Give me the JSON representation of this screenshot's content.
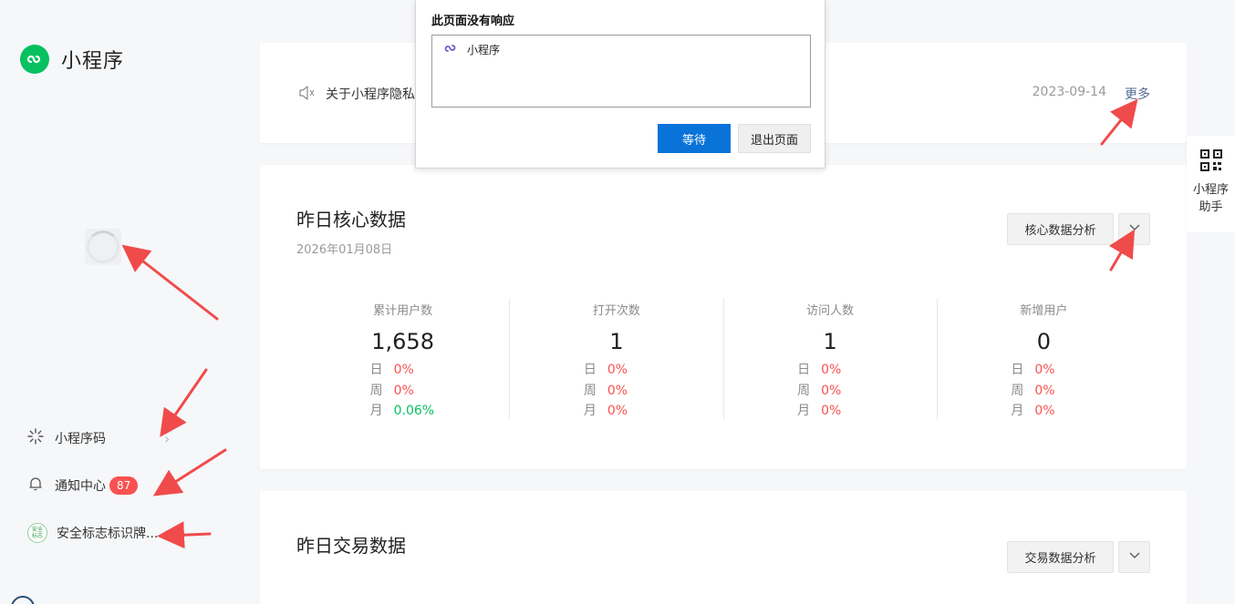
{
  "sidebar": {
    "brand_title": "小程序",
    "items": [
      {
        "label": "小程序码"
      },
      {
        "label": "通知中心",
        "badge": "87"
      },
      {
        "label": "安全标志标识牌...",
        "icon_text": "安全标志"
      }
    ]
  },
  "notice": {
    "text": "关于小程序隐私",
    "date": "2023-09-14",
    "more": "更多"
  },
  "core": {
    "title": "昨日核心数据",
    "date": "2026年01月08日",
    "analysis_button": "核心数据分析",
    "stats": [
      {
        "label": "累计用户数",
        "value": "1,658",
        "day_k": "日",
        "day_v": "0%",
        "week_k": "周",
        "week_v": "0%",
        "month_k": "月",
        "month_v": "0.06%"
      },
      {
        "label": "打开次数",
        "value": "1",
        "day_k": "日",
        "day_v": "0%",
        "week_k": "周",
        "week_v": "0%",
        "month_k": "月",
        "month_v": "0%"
      },
      {
        "label": "访问人数",
        "value": "1",
        "day_k": "日",
        "day_v": "0%",
        "week_k": "周",
        "week_v": "0%",
        "month_k": "月",
        "month_v": "0%"
      },
      {
        "label": "新增用户",
        "value": "0",
        "day_k": "日",
        "day_v": "0%",
        "week_k": "周",
        "week_v": "0%",
        "month_k": "月",
        "month_v": "0%"
      }
    ]
  },
  "trade": {
    "title": "昨日交易数据",
    "analysis_button": "交易数据分析"
  },
  "helper": {
    "line1": "小程序",
    "line2": "助手"
  },
  "dialog": {
    "title": "此页面没有响应",
    "app_name": "小程序",
    "wait_button": "等待",
    "exit_button": "退出页面"
  },
  "colors": {
    "brand_green": "#07c160",
    "negative_red": "#fa5151",
    "primary_blue": "#0a73d9",
    "link_blue": "#576b95",
    "annotation_red": "#f04b4b"
  }
}
